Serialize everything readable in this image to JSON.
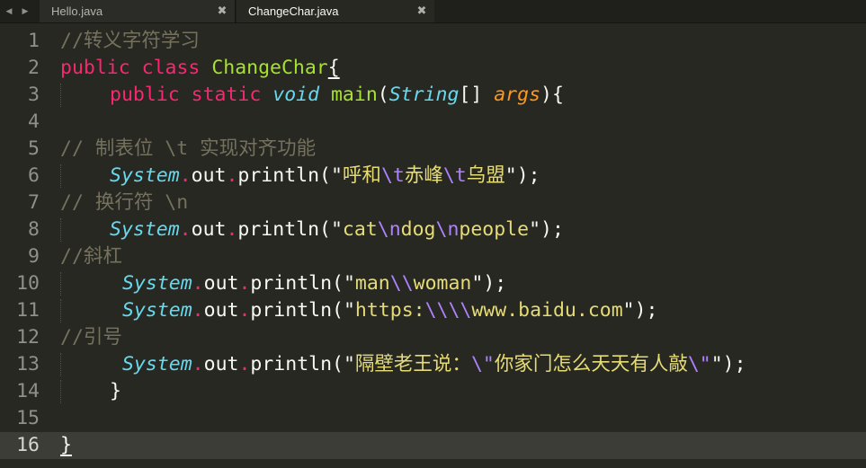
{
  "tabs": [
    {
      "label": "Hello.java",
      "close": "✖",
      "active": false
    },
    {
      "label": "ChangeChar.java",
      "close": "✖",
      "active": true
    }
  ],
  "nav": {
    "prev": "◀",
    "next": "▶"
  },
  "active_line": 16,
  "lines": [
    {
      "n": "1",
      "tokens": [
        {
          "c": "cmt",
          "t": "//转义字符学习"
        }
      ]
    },
    {
      "n": "2",
      "tokens": [
        {
          "c": "kw",
          "t": "public"
        },
        {
          "c": "plain",
          "t": " "
        },
        {
          "c": "kw",
          "t": "class"
        },
        {
          "c": "plain",
          "t": " "
        },
        {
          "c": "cls",
          "t": "ChangeChar"
        },
        {
          "c": "plain u",
          "t": "{"
        }
      ]
    },
    {
      "n": "3",
      "indent": 55,
      "tokens": [
        {
          "c": "kw",
          "t": "public"
        },
        {
          "c": "plain",
          "t": " "
        },
        {
          "c": "kw",
          "t": "static"
        },
        {
          "c": "plain",
          "t": " "
        },
        {
          "c": "type",
          "t": "void"
        },
        {
          "c": "plain",
          "t": " "
        },
        {
          "c": "fn",
          "t": "main"
        },
        {
          "c": "plain",
          "t": "("
        },
        {
          "c": "type",
          "t": "String"
        },
        {
          "c": "plain",
          "t": "[] "
        },
        {
          "c": "param",
          "t": "args"
        },
        {
          "c": "plain",
          "t": "){"
        }
      ]
    },
    {
      "n": "4",
      "tokens": []
    },
    {
      "n": "5",
      "tokens": [
        {
          "c": "cmt",
          "t": "// 制表位 \\t 实现对齐功能"
        }
      ]
    },
    {
      "n": "6",
      "indent": 55,
      "tokens": [
        {
          "c": "type",
          "t": "System"
        },
        {
          "c": "dot",
          "t": "."
        },
        {
          "c": "plain",
          "t": "out"
        },
        {
          "c": "dot",
          "t": "."
        },
        {
          "c": "plain",
          "t": "println(\""
        },
        {
          "c": "str",
          "t": "呼和"
        },
        {
          "c": "esc",
          "t": "\\t"
        },
        {
          "c": "str",
          "t": "赤峰"
        },
        {
          "c": "esc",
          "t": "\\t"
        },
        {
          "c": "str",
          "t": "乌盟"
        },
        {
          "c": "plain",
          "t": "\");"
        }
      ]
    },
    {
      "n": "7",
      "tokens": [
        {
          "c": "cmt",
          "t": "// 换行符 \\n"
        }
      ]
    },
    {
      "n": "8",
      "indent": 55,
      "tokens": [
        {
          "c": "type",
          "t": "System"
        },
        {
          "c": "dot",
          "t": "."
        },
        {
          "c": "plain",
          "t": "out"
        },
        {
          "c": "dot",
          "t": "."
        },
        {
          "c": "plain",
          "t": "println(\""
        },
        {
          "c": "str",
          "t": "cat"
        },
        {
          "c": "esc",
          "t": "\\n"
        },
        {
          "c": "str",
          "t": "dog"
        },
        {
          "c": "esc",
          "t": "\\n"
        },
        {
          "c": "str",
          "t": "people"
        },
        {
          "c": "plain",
          "t": "\");"
        }
      ]
    },
    {
      "n": "9",
      "tokens": [
        {
          "c": "cmt",
          "t": "//斜杠"
        }
      ]
    },
    {
      "n": "10",
      "indent": 69,
      "tokens": [
        {
          "c": "type",
          "t": "System"
        },
        {
          "c": "dot",
          "t": "."
        },
        {
          "c": "plain",
          "t": "out"
        },
        {
          "c": "dot",
          "t": "."
        },
        {
          "c": "plain",
          "t": "println(\""
        },
        {
          "c": "str",
          "t": "man"
        },
        {
          "c": "esc",
          "t": "\\\\"
        },
        {
          "c": "str",
          "t": "woman"
        },
        {
          "c": "plain",
          "t": "\");"
        }
      ]
    },
    {
      "n": "11",
      "indent": 69,
      "tokens": [
        {
          "c": "type",
          "t": "System"
        },
        {
          "c": "dot",
          "t": "."
        },
        {
          "c": "plain",
          "t": "out"
        },
        {
          "c": "dot",
          "t": "."
        },
        {
          "c": "plain",
          "t": "println(\""
        },
        {
          "c": "str",
          "t": "https:"
        },
        {
          "c": "esc",
          "t": "\\\\\\\\"
        },
        {
          "c": "str",
          "t": "www.baidu.com"
        },
        {
          "c": "plain",
          "t": "\");"
        }
      ]
    },
    {
      "n": "12",
      "tokens": [
        {
          "c": "cmt",
          "t": "//引号"
        }
      ]
    },
    {
      "n": "13",
      "indent": 69,
      "tokens": [
        {
          "c": "type",
          "t": "System"
        },
        {
          "c": "dot",
          "t": "."
        },
        {
          "c": "plain",
          "t": "out"
        },
        {
          "c": "dot",
          "t": "."
        },
        {
          "c": "plain",
          "t": "println(\""
        },
        {
          "c": "str",
          "t": "隔壁老王说："
        },
        {
          "c": "esc",
          "t": "\\\""
        },
        {
          "c": "str",
          "t": "你家门怎么天天有人敲"
        },
        {
          "c": "esc",
          "t": "\\\""
        },
        {
          "c": "plain",
          "t": "\");"
        }
      ]
    },
    {
      "n": "14",
      "indent": 55,
      "tokens": [
        {
          "c": "plain",
          "t": "}"
        }
      ]
    },
    {
      "n": "15",
      "tokens": []
    },
    {
      "n": "16",
      "tokens": [
        {
          "c": "plain u",
          "t": "}"
        }
      ]
    }
  ],
  "colors": {
    "background": "#272822",
    "comment": "#75715e",
    "keyword": "#f92672",
    "class_name": "#a6e22e",
    "type": "#66d9ef",
    "param": "#fd971f",
    "string": "#e6db74",
    "escape": "#ae81ff"
  }
}
